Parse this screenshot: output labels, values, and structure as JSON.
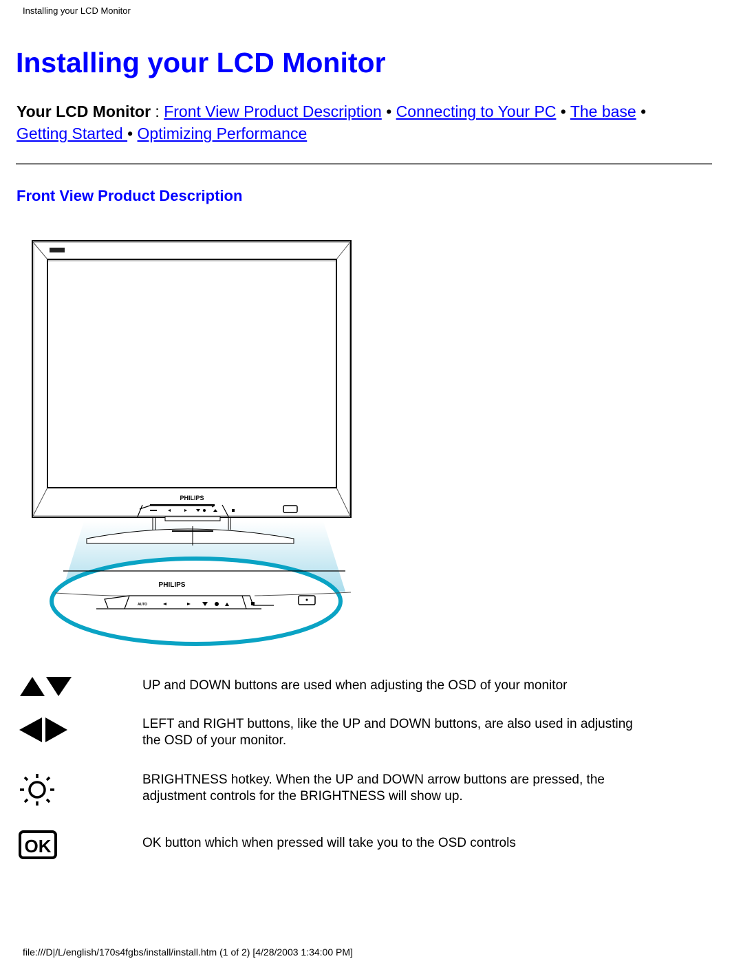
{
  "running_head": "Installing your LCD Monitor",
  "page_title": "Installing your LCD Monitor",
  "nav": {
    "lead": "Your LCD Monitor",
    "separator_colon": " : ",
    "bullet": " • ",
    "links": [
      {
        "label": "Front View Product Description"
      },
      {
        "label": "Connecting to Your PC"
      },
      {
        "label": "The base"
      },
      {
        "label": "Getting Started "
      },
      {
        "label": "Optimizing Performance"
      }
    ]
  },
  "section_title": "Front View Product Description",
  "figure": {
    "brand_label": "PHILIPS",
    "auto_label": "AUTO",
    "callout_color": "#0aa3c4",
    "glow_color": "#bfe6f2"
  },
  "legend": [
    {
      "icon": "up-down-arrows-icon",
      "text": "UP and DOWN buttons are used when adjusting the OSD of your monitor"
    },
    {
      "icon": "left-right-arrows-icon",
      "text": "LEFT and RIGHT buttons, like the UP and DOWN buttons, are also used in adjusting the OSD of your monitor."
    },
    {
      "icon": "brightness-sun-icon",
      "text": "BRIGHTNESS hotkey. When the UP and DOWN arrow buttons are pressed, the adjustment controls for the BRIGHTNESS will show up."
    },
    {
      "icon": "ok-button-icon",
      "text": "OK button which when pressed will take you to the OSD controls",
      "glyph": "OK"
    }
  ],
  "footer": "file:///D|/L/english/170s4fgbs/install/install.htm (1 of 2) [4/28/2003 1:34:00 PM]"
}
